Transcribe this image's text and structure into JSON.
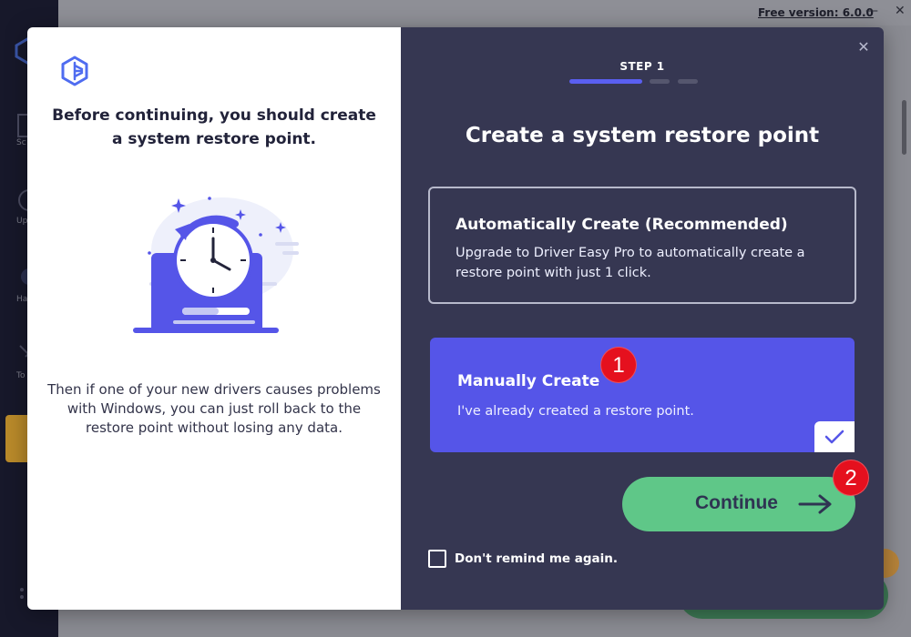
{
  "background_app": {
    "version_label": "Free version: 6.0.0",
    "nav_labels": [
      "Sc",
      "Up",
      "Har",
      "To"
    ],
    "window_controls": [
      "—",
      "✕"
    ]
  },
  "modal": {
    "close_icon": "close-icon",
    "left": {
      "heading": "Before continuing, you should create a system restore point.",
      "description": "Then if one of your new drivers causes problems with Windows, you can just roll back to the restore point without losing any data."
    },
    "right": {
      "step_label": "STEP 1",
      "title": "Create a system restore point",
      "options": [
        {
          "title": "Automatically Create (Recommended)",
          "description": "Upgrade to Driver Easy Pro to automatically create a restore point with just 1 click.",
          "selected": false
        },
        {
          "title": "Manually Create",
          "description": "I've already created a restore point.",
          "selected": true
        }
      ],
      "continue_label": "Continue",
      "dont_remind_label": "Don't remind me again.",
      "dont_remind_checked": false
    }
  },
  "annotations": {
    "badge1": "1",
    "badge2": "2"
  },
  "colors": {
    "accent": "#5555e8",
    "panel": "#363752",
    "continue": "#5fc788",
    "badge": "#e5101e"
  }
}
